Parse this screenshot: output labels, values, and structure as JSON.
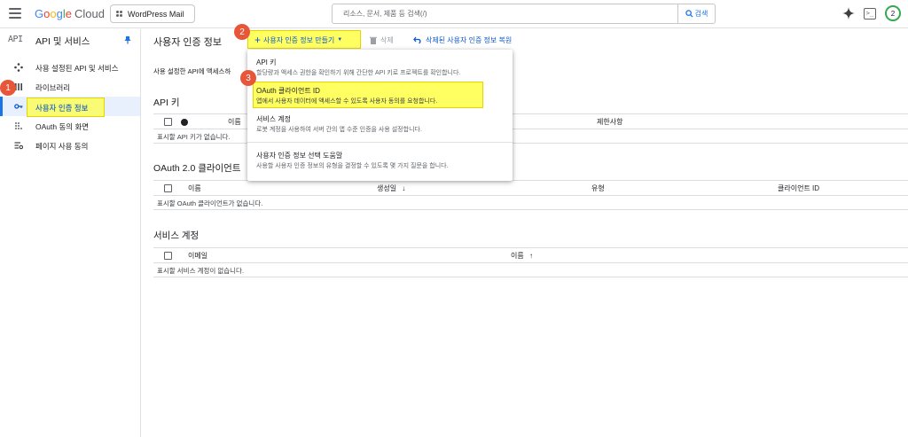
{
  "topbar": {
    "brand_google": "Google",
    "brand_cloud": "Cloud",
    "project_name": "WordPress Mail",
    "search_placeholder": "리소스, 문서, 제품 등 검색(/)",
    "search_button_label": "검색",
    "avatar_initial": "2"
  },
  "sidebar": {
    "header_icon_text": "API",
    "title": "API 및 서비스",
    "items": [
      {
        "label": "사용 설정된 API 및 서비스",
        "icon": "diamond-dots-icon"
      },
      {
        "label": "라이브러리",
        "icon": "library-icon"
      },
      {
        "label": "사용자 인증 정보",
        "icon": "key-icon",
        "active": true
      },
      {
        "label": "OAuth 동의 화면",
        "icon": "dots-grid-icon"
      },
      {
        "label": "페이지 사용 동의",
        "icon": "settings-list-icon"
      }
    ]
  },
  "page": {
    "title": "사용자 인증 정보",
    "create_button": "사용자 인증 정보 만들기",
    "delete_button": "삭제",
    "restore_button": "삭제된 사용자 인증 정보 복원",
    "description": "사용 설정한 API에 액세스하"
  },
  "api_keys": {
    "section_title": "API 키",
    "columns": [
      "이름",
      "제한사항"
    ],
    "empty_text": "표시할 API 키가 없습니다."
  },
  "oauth": {
    "section_title": "OAuth 2.0 클라이언트",
    "columns": [
      "이름",
      "생성일",
      "유형",
      "클라이언트 ID"
    ],
    "empty_text": "표시할 OAuth 클라이언트가 없습니다."
  },
  "service_accounts": {
    "section_title": "서비스 계정",
    "columns": [
      "이메일",
      "이름"
    ],
    "empty_text": "표시할 서비스 계정이 없습니다."
  },
  "dropdown": {
    "items": [
      {
        "title": "API 키",
        "description": "할당량과 액세스 권한을 확인하기 위해 간단한 API 키로 프로젝트를 확인합니다."
      },
      {
        "title": "OAuth 클라이언트 ID",
        "description": "앱에서 사용자 데이터에 액세스할 수 있도록 사용자 동의를 요청합니다."
      },
      {
        "title": "서비스 계정",
        "description": "로봇 계정을 사용하여 서버 간의 앱 수준 인증을 사용 설정합니다."
      },
      {
        "title": "사용자 인증 정보 선택 도움말",
        "description": "사용할 사용자 인증 정보의 유형을 결정할 수 있도록 몇 가지 질문을 합니다."
      }
    ]
  },
  "annotations": {
    "step1": "1",
    "step2": "2",
    "step3": "3",
    "badge_color": "#e8563a",
    "highlight_color": "#ffff46"
  }
}
